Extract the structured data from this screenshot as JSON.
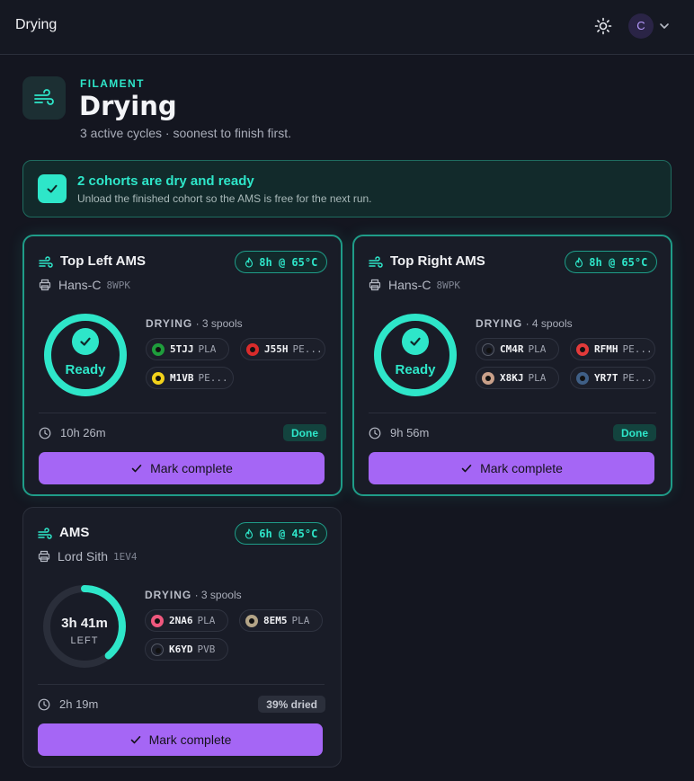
{
  "app": {
    "title": "Drying",
    "avatar_initial": "C"
  },
  "header": {
    "eyebrow": "FILAMENT",
    "title": "Drying",
    "subtitle": "3 active cycles · soonest to finish first."
  },
  "banner": {
    "title": "2 cohorts are dry and ready",
    "subtitle": "Unload the finished cohort so the AMS is free for the next run."
  },
  "colors": {
    "accent": "#2ee6c9",
    "button": "#a566f5",
    "background": "#141620"
  },
  "cards": [
    {
      "name": "Top Left AMS",
      "temp": "8h @ 65°C",
      "printer": "Hans-C",
      "printer_code": "8WPK",
      "status": "ready",
      "ring_text": "Ready",
      "drying_label": "DRYING",
      "spool_count": "· 3 spools",
      "spools": [
        {
          "code": "5TJJ",
          "material": "PLA",
          "color": "#1f9d3c"
        },
        {
          "code": "J55H",
          "material": "PE...",
          "color": "#d92b2b"
        },
        {
          "code": "M1VB",
          "material": "PE...",
          "color": "#f2d21b"
        }
      ],
      "elapsed": "10h 26m",
      "badge": "Done",
      "button": "Mark complete",
      "progress": 1.0
    },
    {
      "name": "Top Right AMS",
      "temp": "8h @ 65°C",
      "printer": "Hans-C",
      "printer_code": "8WPK",
      "status": "ready",
      "ring_text": "Ready",
      "drying_label": "DRYING",
      "spool_count": "· 4 spools",
      "spools": [
        {
          "code": "CM4R",
          "material": "PLA",
          "color": "#1c1f2a"
        },
        {
          "code": "RFMH",
          "material": "PE...",
          "color": "#e23a3a"
        },
        {
          "code": "X8KJ",
          "material": "PLA",
          "color": "#c9a08a"
        },
        {
          "code": "YR7T",
          "material": "PE...",
          "color": "#3f5f86"
        }
      ],
      "elapsed": "9h 56m",
      "badge": "Done",
      "button": "Mark complete",
      "progress": 1.0
    },
    {
      "name": "AMS",
      "temp": "6h @ 45°C",
      "printer": "Lord Sith",
      "printer_code": "1EV4",
      "status": "drying",
      "ring_time": "3h 41m",
      "ring_sub": "LEFT",
      "drying_label": "DRYING",
      "spool_count": "· 3 spools",
      "spools": [
        {
          "code": "2NA6",
          "material": "PLA",
          "color": "#f0587e"
        },
        {
          "code": "8EM5",
          "material": "PLA",
          "color": "#b3a487"
        },
        {
          "code": "K6YD",
          "material": "PVB",
          "color": "#1c1f2a"
        }
      ],
      "elapsed": "2h 19m",
      "badge": "39% dried",
      "button": "Mark complete",
      "progress": 0.39
    }
  ]
}
